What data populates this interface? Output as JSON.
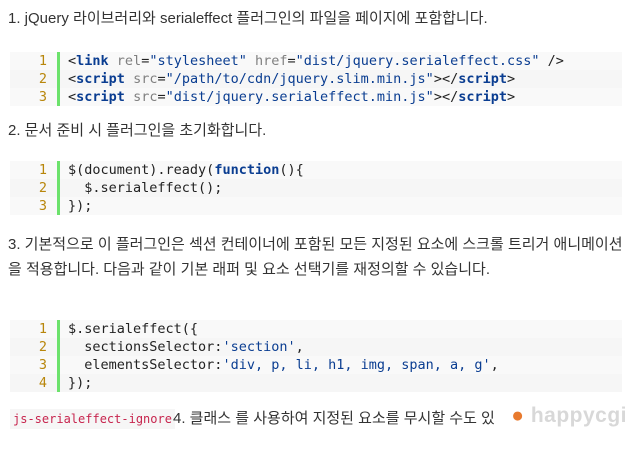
{
  "step1": {
    "text": "1. jQuery 라이브러리와 serialeffect 플러그인의 파일을 페이지에 포함합니다."
  },
  "code1": {
    "lines": [
      {
        "num": "1",
        "tokens": [
          "<",
          "link",
          " ",
          "rel",
          "=",
          "\"stylesheet\"",
          " ",
          "href",
          "=",
          "\"dist/jquery.serialeffect.css\"",
          " />"
        ]
      },
      {
        "num": "2",
        "tokens": [
          "<",
          "script",
          " ",
          "src",
          "=",
          "\"/path/to/cdn/jquery.slim.min.js\"",
          "></",
          "script",
          ">"
        ]
      },
      {
        "num": "3",
        "tokens": [
          "<",
          "script",
          " ",
          "src",
          "=",
          "\"dist/jquery.serialeffect.min.js\"",
          "></",
          "script",
          ">"
        ]
      }
    ]
  },
  "step2": {
    "text": "2. 문서 준비 시 플러그인을 초기화합니다."
  },
  "code2": {
    "lines": [
      {
        "num": "1",
        "pre": "$(document).ready(",
        "kw": "function",
        "post": "(){"
      },
      {
        "num": "2",
        "pre": "  $.serialeffect();"
      },
      {
        "num": "3",
        "pre": "});"
      }
    ]
  },
  "step3": {
    "text": "3. 기본적으로 이 플러그인은 섹션 컨테이너에 포함된 모든 지정된 요소에 스크롤 트리거 애니메이션을 적용합니다. 다음과 같이 기본 래퍼 및 요소 선택기를 재정의할 수 있습니다."
  },
  "code3": {
    "lines": [
      {
        "num": "1",
        "pre": "$.serialeffect({"
      },
      {
        "num": "2",
        "pre": "  sectionsSelector:",
        "str": "'section'",
        "post": ","
      },
      {
        "num": "3",
        "pre": "  elementsSelector:",
        "str": "'div, p, li, h1, img, span, a, g'",
        "post": ","
      },
      {
        "num": "4",
        "pre": "});"
      }
    ]
  },
  "step4": {
    "code": "js-serialeffect-ignore",
    "text": "4. 클래스 를 사용하여 지정된 요소를 무시할 수도 있"
  },
  "watermark": {
    "text": "happycgi"
  },
  "colors": {
    "gutter": "#6ce26c",
    "keyword": "#0a3d91",
    "line_number": "#b8860b",
    "inline_code": "#c7254e"
  }
}
